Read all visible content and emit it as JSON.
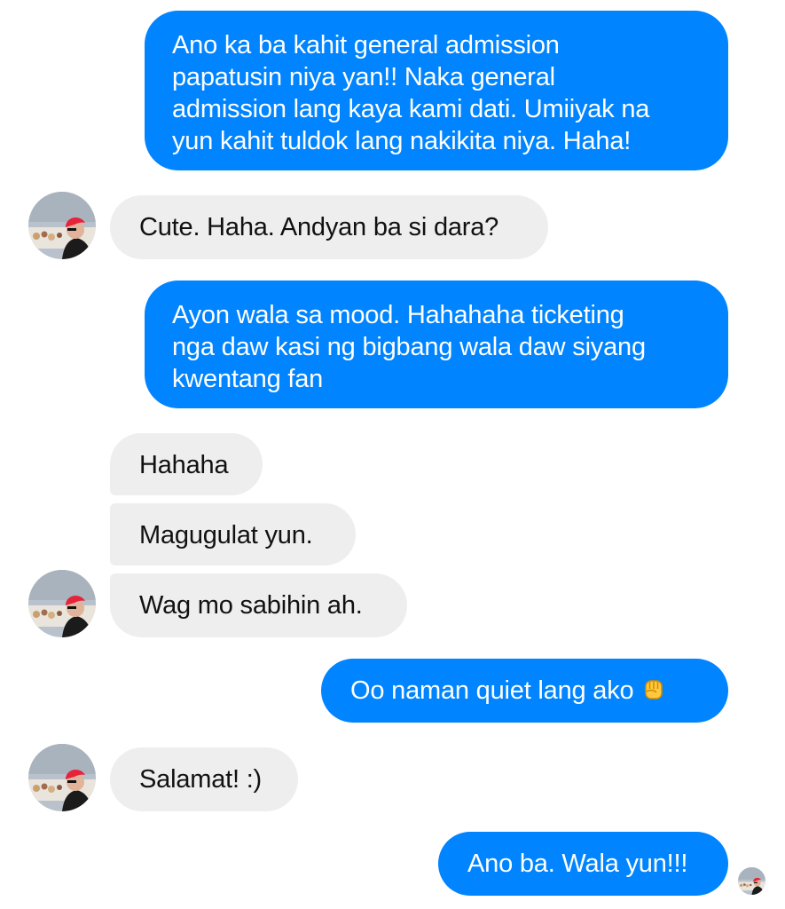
{
  "conversation": {
    "messages": [
      {
        "side": "outgoing",
        "text": "Ano ka ba kahit general admission\npapatusin niya yan!! Naka general\nadmission lang kaya kami dati. Umiiyak na\nyun kahit tuldok lang nakikita niya. Haha!"
      },
      {
        "side": "incoming",
        "text": "Cute. Haha. Andyan ba si dara?"
      },
      {
        "side": "outgoing",
        "text": "Ayon wala sa mood. Hahahaha ticketing\nnga daw kasi ng bigbang wala daw siyang\nkwentang fan"
      },
      {
        "side": "incoming",
        "text": "Hahaha"
      },
      {
        "side": "incoming",
        "text": "Magugulat yun."
      },
      {
        "side": "incoming",
        "text": "Wag mo sabihin ah."
      },
      {
        "side": "outgoing",
        "text": "Oo naman quiet lang ako",
        "emoji": "raised-fist-emoji"
      },
      {
        "side": "incoming",
        "text": "Salamat! :)"
      },
      {
        "side": "outgoing",
        "text": "Ano ba. Wala yun!!!"
      }
    ]
  },
  "colors": {
    "outgoing_bubble": "#0084ff",
    "incoming_bubble": "#eeeeee",
    "background": "#ffffff"
  },
  "icons": {
    "contact_avatar": "contact-avatar",
    "seen_indicator": "seen-avatar-icon"
  }
}
